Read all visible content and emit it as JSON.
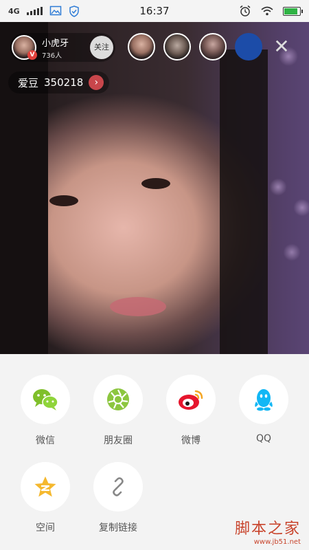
{
  "status_bar": {
    "network": "4G",
    "time": "16:37",
    "battery_level": 0.85
  },
  "live": {
    "host": {
      "name": "小虎牙",
      "viewers_count": "736人",
      "badge": "V",
      "follow_label": "关注"
    },
    "aidou": {
      "label": "爱豆",
      "value": "350218"
    }
  },
  "share_sheet": {
    "items": [
      {
        "label": "微信",
        "icon": "wechat-icon",
        "color": "#7fbf2a"
      },
      {
        "label": "朋友圈",
        "icon": "moments-icon",
        "color": "#8cc63f"
      },
      {
        "label": "微博",
        "icon": "weibo-icon",
        "color": "#e6162d"
      },
      {
        "label": "QQ",
        "icon": "qq-icon",
        "color": "#12b7f5"
      },
      {
        "label": "空间",
        "icon": "qzone-icon",
        "color": "#f5b82e"
      },
      {
        "label": "复制链接",
        "icon": "link-icon",
        "color": "#888888"
      }
    ]
  },
  "watermark": {
    "title": "脚本之家",
    "url": "www.jb51.net"
  }
}
